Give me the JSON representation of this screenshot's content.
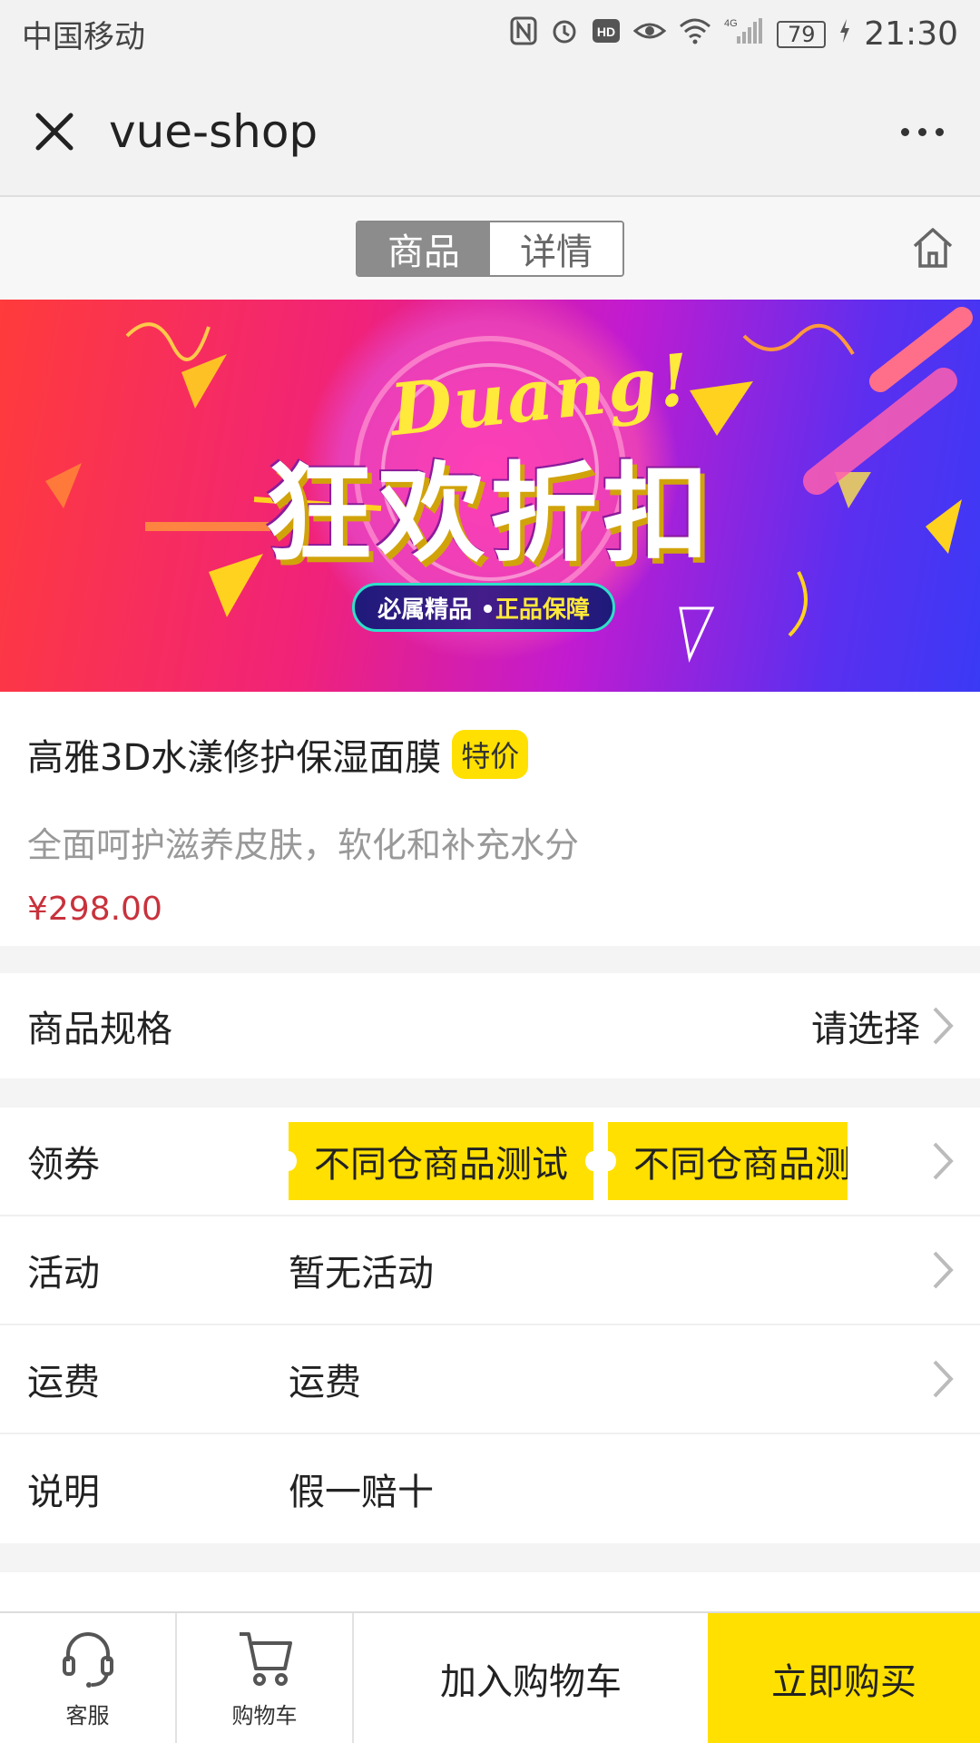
{
  "status_bar": {
    "carrier": "中国移动",
    "network": "4G",
    "battery": "79",
    "time": "21:30",
    "icons": [
      "nfc-icon",
      "alarm-icon",
      "hd-icon",
      "eye-icon",
      "wifi-icon",
      "signal-icon",
      "charging-icon"
    ]
  },
  "titlebar": {
    "title": "vue-shop"
  },
  "tabs": {
    "goods": "商品",
    "detail": "详情"
  },
  "banner": {
    "headline_script": "Duang!",
    "headline": "狂欢折扣",
    "slogan_part1": "必属精品 •",
    "slogan_part2": "正品保障"
  },
  "product": {
    "title": "高雅3D水漾修护保湿面膜",
    "badge": "特价",
    "description": "全面呵护滋养皮肤，软化和补充水分",
    "price": "¥298.00"
  },
  "spec": {
    "label": "商品规格",
    "action": "请选择"
  },
  "coupon_row": {
    "label": "领券",
    "coupons": [
      "不同仓商品测试",
      "不同仓商品测"
    ]
  },
  "activity": {
    "label": "活动",
    "value": "暂无活动"
  },
  "shipping": {
    "label": "运费",
    "value": "运费"
  },
  "note": {
    "label": "说明",
    "value": "假一赔十"
  },
  "actionbar": {
    "service": "客服",
    "cart": "购物车",
    "add_to_cart": "加入购物车",
    "buy_now": "立即购买"
  },
  "colors": {
    "accent_yellow": "#ffe000",
    "price_red": "#c8323c"
  }
}
